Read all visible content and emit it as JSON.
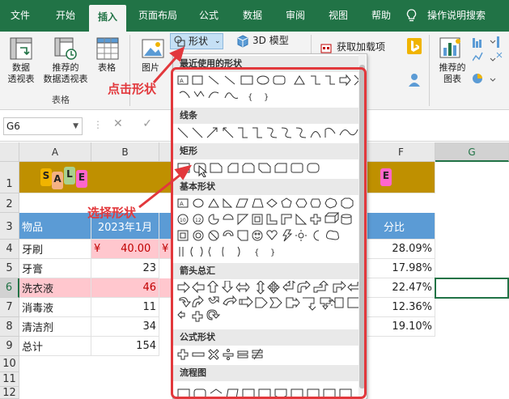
{
  "menubar": {
    "tabs": [
      "文件",
      "开始",
      "插入",
      "页面布局",
      "公式",
      "数据",
      "审阅",
      "视图",
      "帮助"
    ],
    "active_tab": "插入",
    "help_search": "操作说明搜索"
  },
  "ribbon": {
    "pivot_table": "数据\n透视表",
    "recommended_pivot": "推荐的\n数据透视表",
    "table": "表格",
    "tables_group": "表格",
    "picture": "图片",
    "shapes_button": "形状",
    "model_3d": "3D 模型",
    "get_addins": "获取加载项",
    "recommended_charts": "推荐的\n图表"
  },
  "formula_bar": {
    "name_box": "G6"
  },
  "grid": {
    "col_headers": [
      "A",
      "B",
      "F",
      "G"
    ],
    "selected_col": "G",
    "row_headers": [
      "1",
      "2",
      "3",
      "4",
      "5",
      "6",
      "7",
      "8",
      "9",
      "10",
      "11",
      "12"
    ],
    "selected_row": "6",
    "sale_letters": [
      "S",
      "A",
      "L",
      "E"
    ],
    "header_item": "物品",
    "header_date": "2023年1月",
    "header_share": "分比",
    "items": [
      "牙刷",
      "牙膏",
      "洗衣液",
      "消毒液",
      "清洁剂",
      "总计"
    ],
    "b_values": [
      "¥      40.00",
      "23",
      "46",
      "11",
      "34",
      "154"
    ],
    "b4_partial": "¥",
    "f_values": [
      "28.09%",
      "17.98%",
      "22.47%",
      "12.36%",
      "19.10%"
    ]
  },
  "dropdown": {
    "sections": [
      "最近使用的形状",
      "线条",
      "矩形",
      "基本形状",
      "箭头总汇",
      "公式形状",
      "流程图"
    ]
  },
  "annotations": {
    "click_shapes": "点击形状",
    "select_shape": "选择形状"
  },
  "colors": {
    "excel_green": "#217346",
    "accent_red": "#e2383c",
    "header_blue": "#5b9bd5",
    "pink_fill": "#ffc7ce",
    "gold_fill": "#bf9000"
  }
}
